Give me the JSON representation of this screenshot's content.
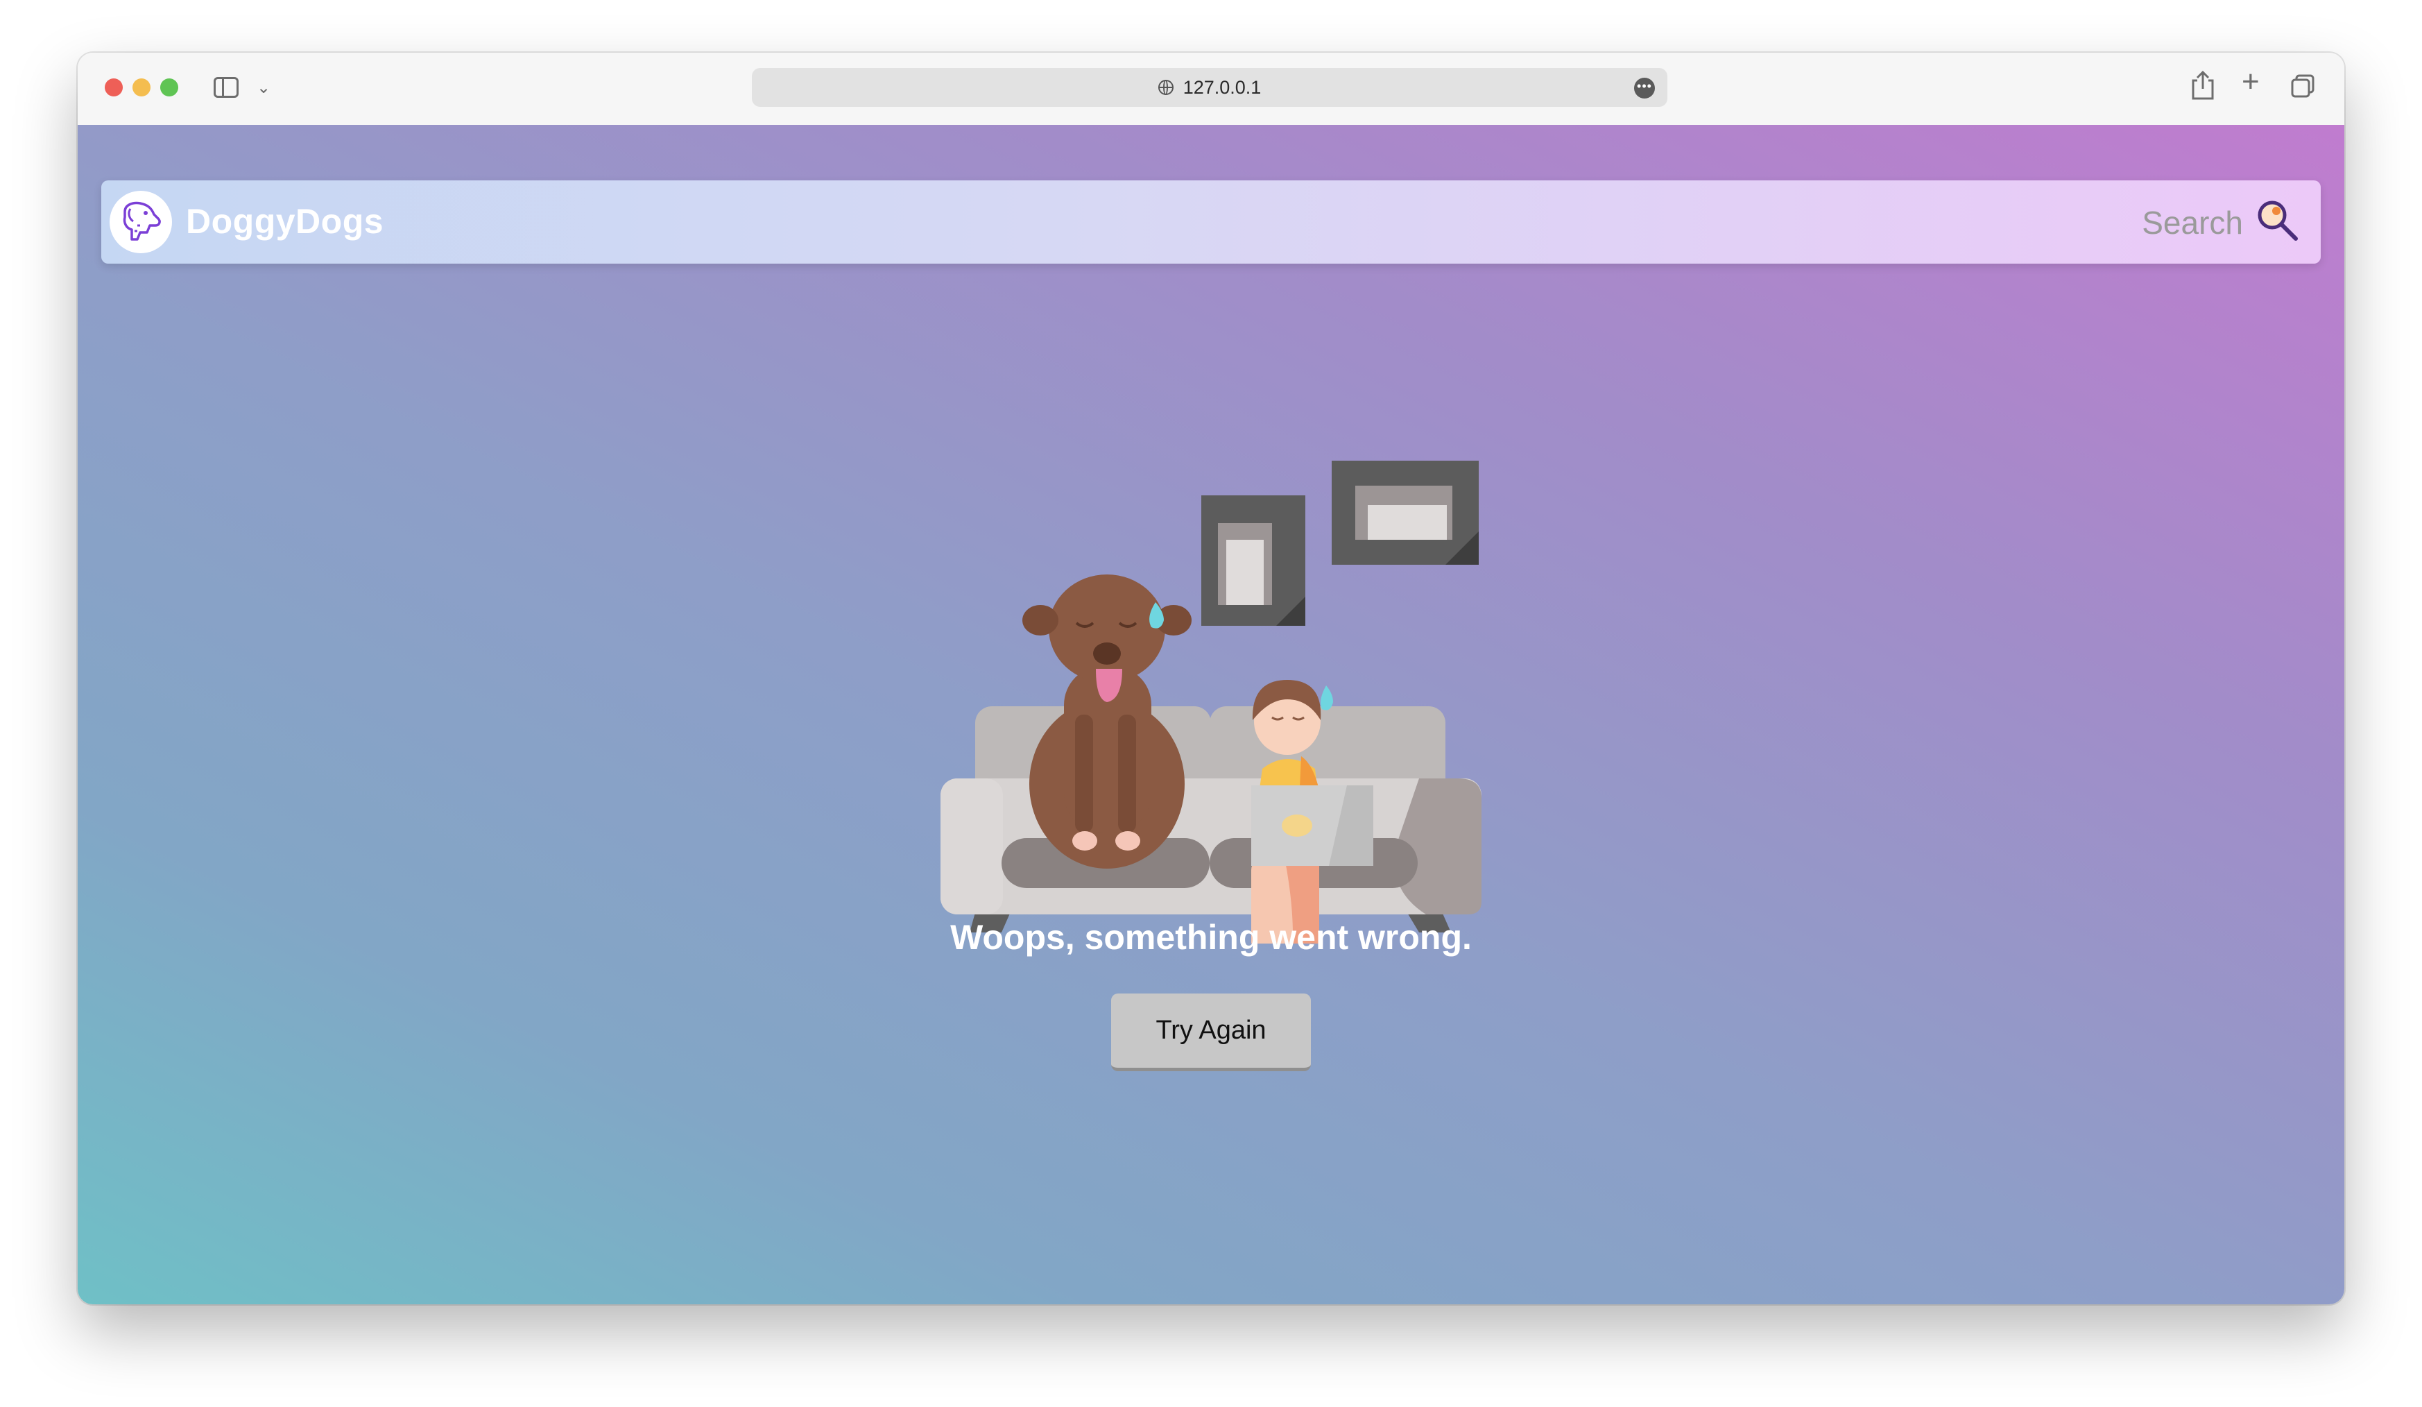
{
  "browser": {
    "url": "127.0.0.1",
    "more_label": "•••"
  },
  "navbar": {
    "brand": "DoggyDogs",
    "search_label": "Search"
  },
  "main": {
    "error_message": "Woops, something went wrong.",
    "retry_button": "Try Again"
  },
  "colors": {
    "gradient_start": "#6fc0c6",
    "gradient_end": "#c07ccf",
    "button_bg": "#c7c7c7",
    "logo_accent": "#7b3fd6"
  }
}
